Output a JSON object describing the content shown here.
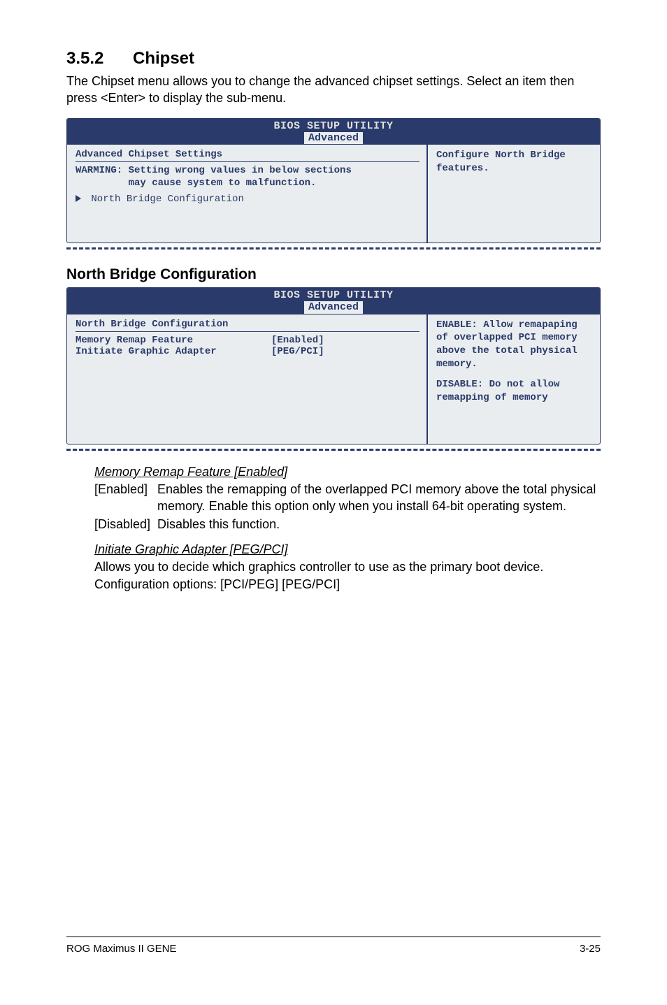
{
  "section": {
    "number": "3.5.2",
    "title": "Chipset",
    "intro": "The Chipset menu allows you to change the advanced chipset settings. Select an item then press <Enter> to display the sub-menu."
  },
  "panel1": {
    "header_title": "BIOS SETUP UTILITY",
    "header_tab": "Advanced",
    "left_title": "Advanced Chipset Settings",
    "warning": "WARMING: Setting wrong values in below sections\n         may cause system to malfunction.",
    "arrow_item": "North Bridge Configuration",
    "right_text": "Configure North Bridge features."
  },
  "subhead": "North Bridge Configuration",
  "panel2": {
    "header_title": "BIOS SETUP UTILITY",
    "header_tab": "Advanced",
    "left_title": "North Bridge Configuration",
    "rows": [
      {
        "label": "Memory Remap Feature",
        "value": "[Enabled]"
      },
      {
        "label": "Initiate Graphic Adapter",
        "value": "[PEG/PCI]"
      }
    ],
    "right_block1": "ENABLE: Allow remapaping of overlapped PCI memory above the total physical memory.",
    "right_block2": "DISABLE: Do not allow remapping of memory"
  },
  "memory_remap": {
    "title": "Memory Remap Feature [Enabled]",
    "enabled_tag": "[Enabled]",
    "enabled_text": "Enables the remapping of the overlapped PCI memory above the total physical memory. Enable this option only when you install 64-bit operating system.",
    "disabled_tag": "[Disabled]",
    "disabled_text": "Disables this function."
  },
  "initiate": {
    "title": "Initiate Graphic Adapter [PEG/PCI]",
    "body": "Allows you to decide which graphics controller to use as the primary boot device. Configuration options: [PCI/PEG] [PEG/PCI]"
  },
  "footer": {
    "left": "ROG Maximus II GENE",
    "right": "3-25"
  }
}
